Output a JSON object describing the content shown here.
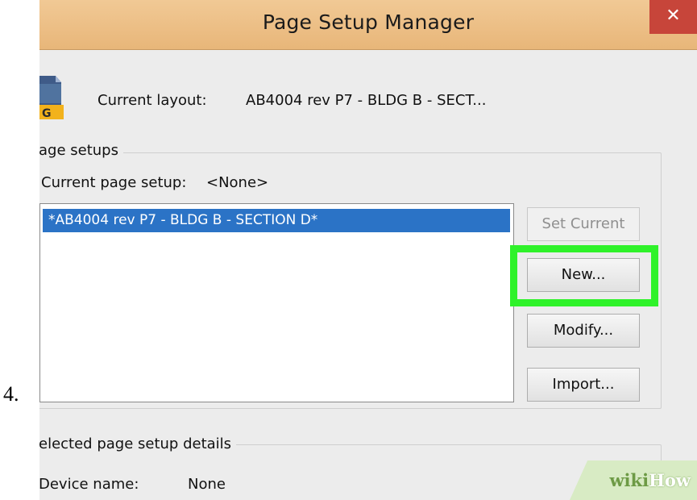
{
  "step_number": "4.",
  "dialog": {
    "title": "Page Setup Manager",
    "close_glyph": "✕",
    "current_layout": {
      "label": "Current layout:",
      "value": "AB4004 rev P7 - BLDG B - SECT...",
      "icon": "dwg-file-icon",
      "icon_text": "G"
    },
    "page_setups": {
      "group_label": "age setups",
      "current_label": "Current page setup:",
      "current_value": "<None>",
      "items": [
        {
          "label": "*AB4004 rev P7 - BLDG B - SECTION D*",
          "selected": true
        }
      ],
      "buttons": {
        "set_current": "Set Current",
        "new": "New...",
        "modify": "Modify...",
        "import": "Import..."
      }
    },
    "details": {
      "group_label": "elected page setup details",
      "device_label": "Device name:",
      "device_value": "None"
    }
  },
  "watermark": {
    "wiki": "wiki",
    "how": "How"
  },
  "colors": {
    "titlebar": "#e8b679",
    "close_button": "#c7453a",
    "selection": "#2b73c6",
    "highlight": "#2ff22a"
  }
}
